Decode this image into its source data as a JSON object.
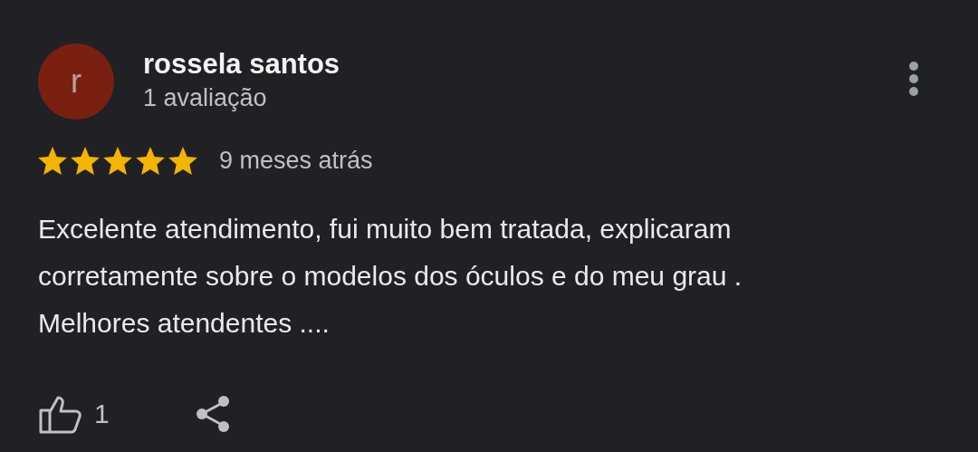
{
  "review": {
    "author": "rossela santos",
    "avatar_letter": "r",
    "reviews_count": "1 avaliação",
    "stars": 5,
    "time": "9 meses atrás",
    "text": "Excelente atendimento, fui muito bem tratada, explicaram\ncorretamente sobre o modelos dos óculos e do meu grau .\nMelhores atendentes ....",
    "likes": "1"
  }
}
